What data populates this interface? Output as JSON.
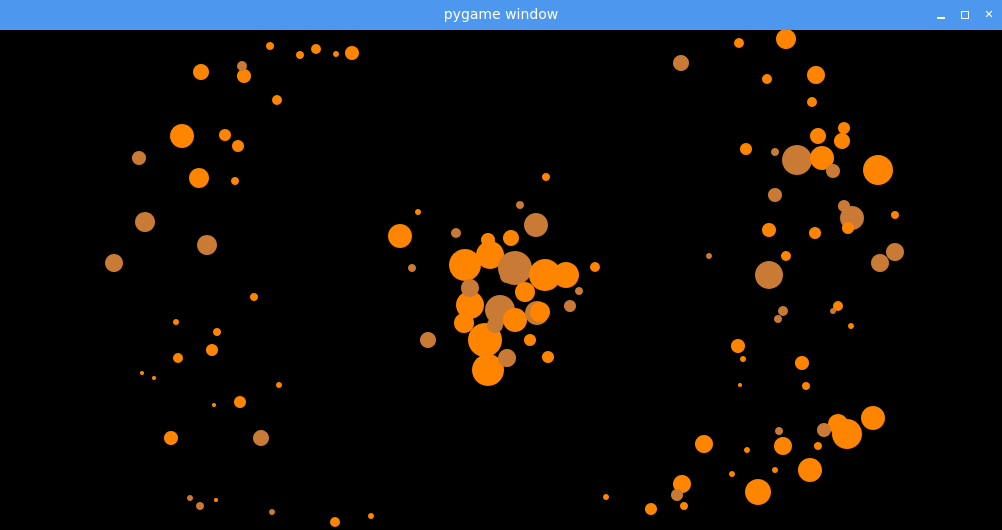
{
  "window": {
    "title": "pygame window",
    "controls": {
      "minimize": "minimize-icon",
      "maximize": "maximize-icon",
      "close": "close-icon",
      "close_glyph": "✕"
    },
    "colors": {
      "titlebar": "#4e97ef",
      "background": "#000000",
      "particle_bright": "#ff8500",
      "particle_muted": "#c97a35"
    }
  }
}
